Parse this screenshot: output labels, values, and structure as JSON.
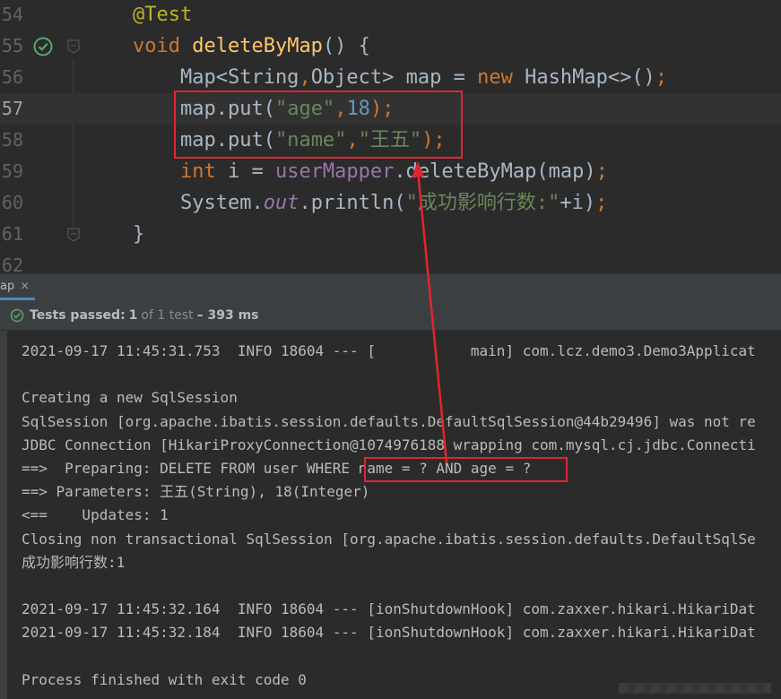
{
  "editor": {
    "lines": [
      {
        "num": "54",
        "tokens": [
          {
            "t": "@Test",
            "c": "t-ann"
          }
        ]
      },
      {
        "num": "55",
        "tokens": [
          {
            "t": "void ",
            "c": "t-kw"
          },
          {
            "t": "deleteByMap",
            "c": "t-fn"
          },
          {
            "t": "() {",
            "c": "t-plain"
          }
        ],
        "run_icon": true,
        "fold": true
      },
      {
        "num": "56",
        "tokens": [
          {
            "t": "    Map<String",
            "c": "t-plain"
          },
          {
            "t": ",",
            "c": "t-kw"
          },
          {
            "t": "Object> map = ",
            "c": "t-plain"
          },
          {
            "t": "new ",
            "c": "t-kw"
          },
          {
            "t": "HashMap<>()",
            "c": "t-plain"
          },
          {
            "t": ";",
            "c": "t-kw"
          }
        ]
      },
      {
        "num": "57",
        "tokens": [
          {
            "t": "    map.put(",
            "c": "t-plain"
          },
          {
            "t": "\"age\"",
            "c": "t-str"
          },
          {
            "t": ",",
            "c": "t-kw"
          },
          {
            "t": "18",
            "c": "t-num"
          },
          {
            "t": ");",
            "c": "t-kw"
          }
        ],
        "current": true
      },
      {
        "num": "58",
        "tokens": [
          {
            "t": "    map.put(",
            "c": "t-plain"
          },
          {
            "t": "\"name\"",
            "c": "t-str"
          },
          {
            "t": ",",
            "c": "t-kw"
          },
          {
            "t": "\"王五\"",
            "c": "t-str"
          },
          {
            "t": ");",
            "c": "t-kw"
          }
        ]
      },
      {
        "num": "59",
        "tokens": [
          {
            "t": "    ",
            "c": "t-plain"
          },
          {
            "t": "int ",
            "c": "t-kw"
          },
          {
            "t": "i = ",
            "c": "t-plain"
          },
          {
            "t": "userMapper",
            "c": "t-field"
          },
          {
            "t": ".deleteByMap(map)",
            "c": "t-plain"
          },
          {
            "t": ";",
            "c": "t-kw"
          }
        ]
      },
      {
        "num": "60",
        "tokens": [
          {
            "t": "    System.",
            "c": "t-plain"
          },
          {
            "t": "out",
            "c": "t-italic-field"
          },
          {
            "t": ".println(",
            "c": "t-plain"
          },
          {
            "t": "\"成功影响行数:\"",
            "c": "t-str"
          },
          {
            "t": "+i)",
            "c": "t-plain"
          },
          {
            "t": ";",
            "c": "t-kw"
          }
        ]
      },
      {
        "num": "61",
        "tokens": [
          {
            "t": "}",
            "c": "t-plain"
          }
        ],
        "fold": true
      },
      {
        "num": "62",
        "tokens": []
      }
    ]
  },
  "run": {
    "tab_label": "ap",
    "tab_close": "×",
    "status": {
      "passed": "Tests passed:",
      "count": "1",
      "of": "of 1 test",
      "time": "– 393 ms"
    }
  },
  "console": {
    "lines": [
      "2021-09-17 11:45:31.753  INFO 18604 --- [           main] com.lcz.demo3.Demo3Applicat",
      "",
      "Creating a new SqlSession",
      "SqlSession [org.apache.ibatis.session.defaults.DefaultSqlSession@44b29496] was not re",
      "JDBC Connection [HikariProxyConnection@1074976188 wrapping com.mysql.cj.jdbc.Connecti",
      "==>  Preparing: DELETE FROM user WHERE name = ? AND age = ?",
      "==> Parameters: 王五(String), 18(Integer)",
      "<==    Updates: 1",
      "Closing non transactional SqlSession [org.apache.ibatis.session.defaults.DefaultSqlSe",
      "成功影响行数:1",
      "",
      "2021-09-17 11:45:32.164  INFO 18604 --- [ionShutdownHook] com.zaxxer.hikari.HikariDat",
      "2021-09-17 11:45:32.184  INFO 18604 --- [ionShutdownHook] com.zaxxer.hikari.HikariDat",
      "",
      "Process finished with exit code 0"
    ]
  },
  "colors": {
    "highlight": "#e0262f",
    "pass_green": "#59a869"
  }
}
